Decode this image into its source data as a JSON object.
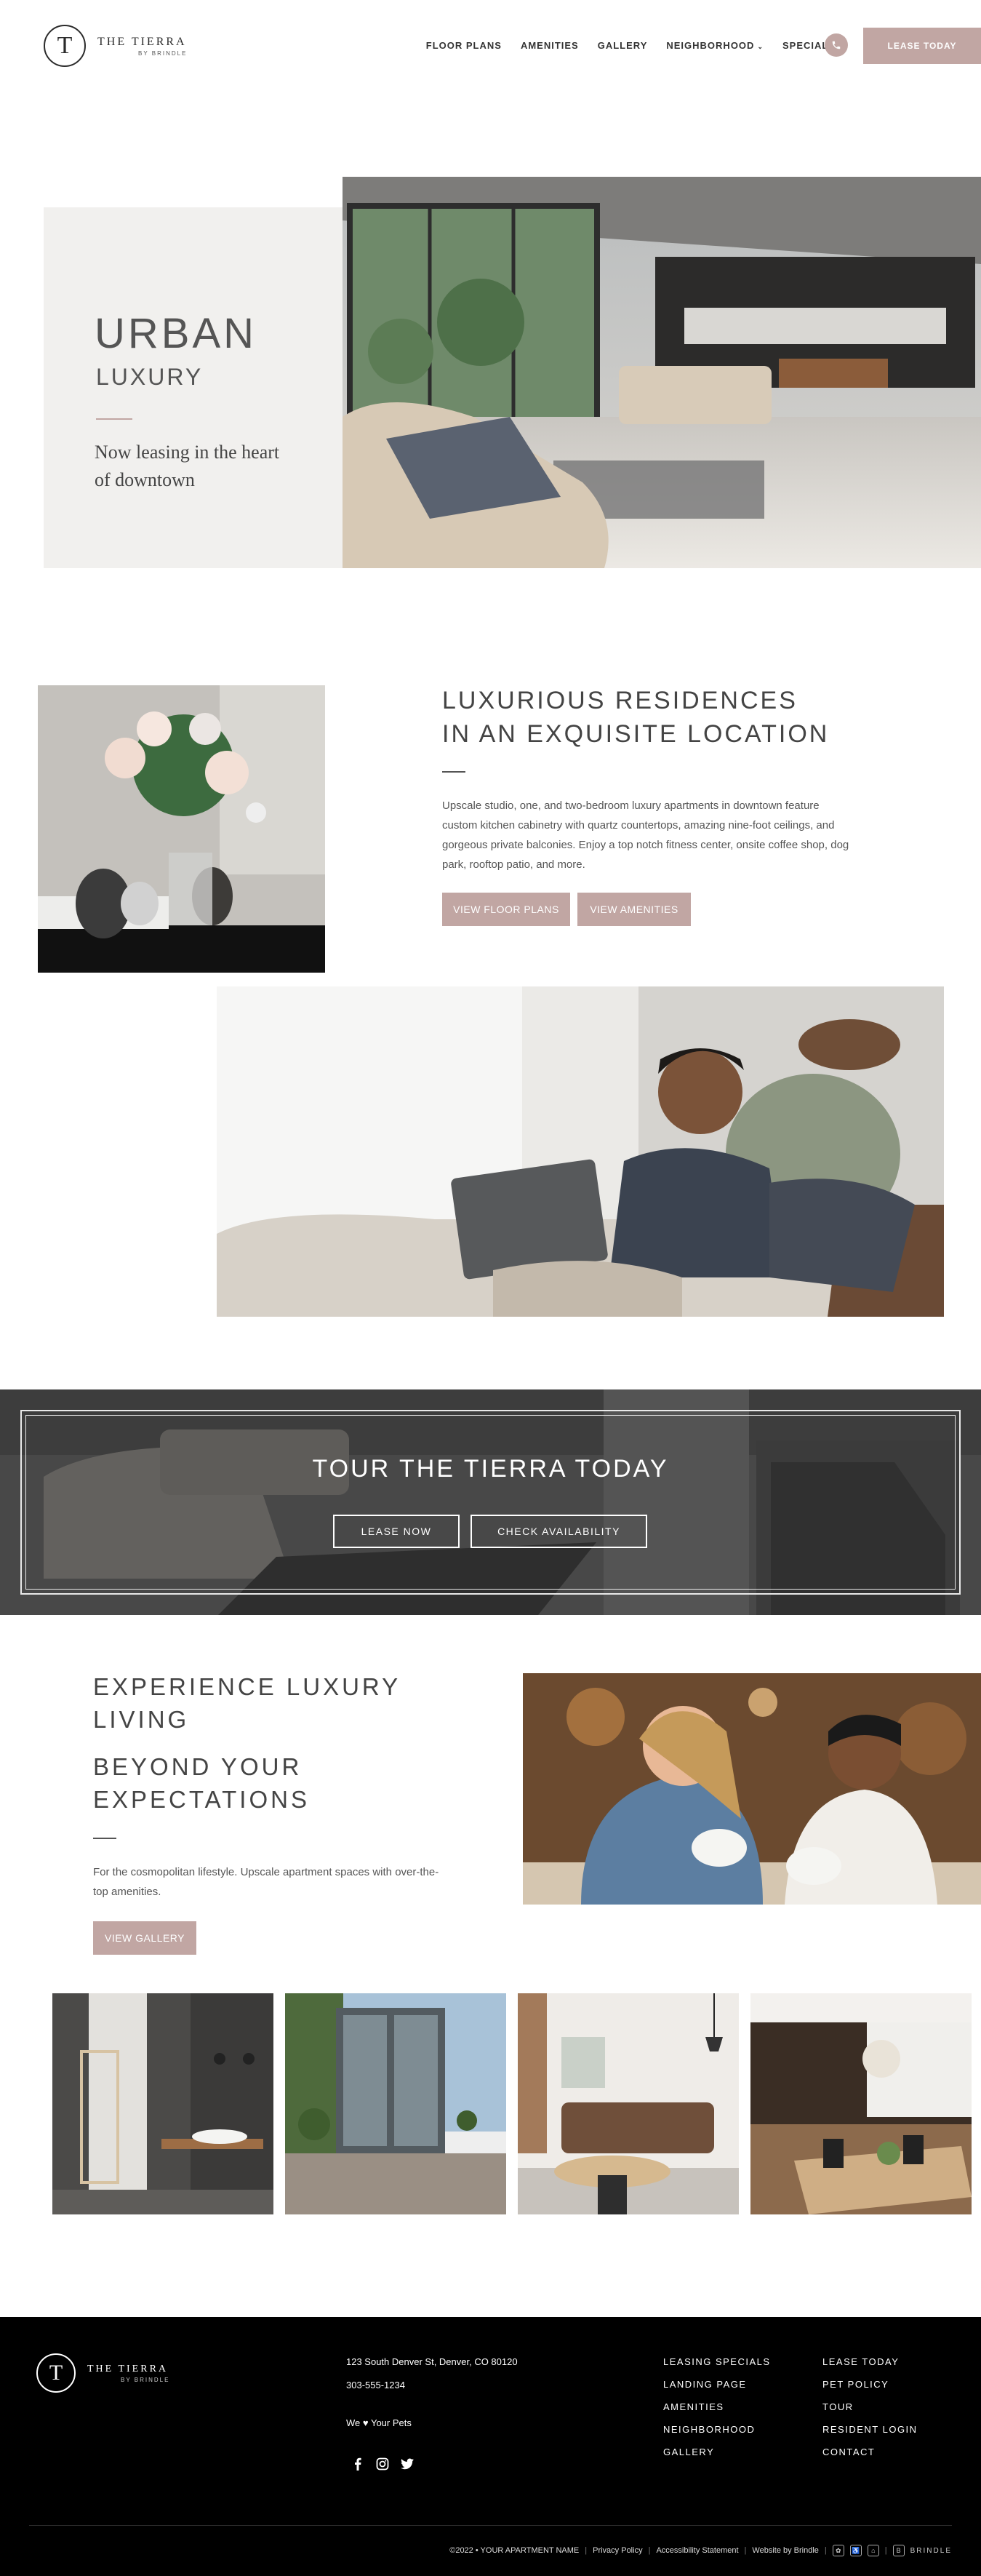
{
  "header": {
    "logo_letter": "T",
    "logo_name": "THE TIERRA",
    "logo_sub": "BY BRINDLE",
    "nav": [
      {
        "label": "FLOOR PLANS"
      },
      {
        "label": "AMENITIES"
      },
      {
        "label": "GALLERY"
      },
      {
        "label": "NEIGHBORHOOD"
      },
      {
        "label": "SPECIALS"
      }
    ],
    "lease_label": "LEASE TODAY"
  },
  "hero": {
    "title": "URBAN",
    "subtitle": "LUXURY",
    "tagline": "Now leasing in the heart of downtown"
  },
  "residences": {
    "heading_line1": "LUXURIOUS RESIDENCES",
    "heading_line2": "IN AN EXQUISITE LOCATION",
    "body": "Upscale studio, one, and two-bedroom luxury apartments in downtown feature custom kitchen cabinetry with quartz countertops, amazing nine-foot ceilings, and gorgeous private balconies. Enjoy a top notch fitness center, onsite coffee shop, dog park, rooftop patio, and more.",
    "btn_floor_plans": "VIEW FLOOR PLANS",
    "btn_amenities": "VIEW AMENITIES"
  },
  "tour": {
    "title": "TOUR THE TIERRA TODAY",
    "btn_lease": "LEASE NOW",
    "btn_availability": "CHECK AVAILABILITY"
  },
  "experience": {
    "heading1_line1": "EXPERIENCE LUXURY",
    "heading1_line2": "LIVING",
    "heading2_line1": "BEYOND YOUR",
    "heading2_line2": "EXPECTATIONS",
    "body": "For the cosmopolitan lifestyle. Upscale apartment spaces with over-the-top amenities.",
    "btn_gallery": "VIEW GALLERY"
  },
  "footer": {
    "logo_letter": "T",
    "logo_name": "THE TIERRA",
    "logo_sub": "BY BRINDLE",
    "address": "123 South Denver St, Denver, CO 80120",
    "phone": "303-555-1234",
    "pets": "We ♥ Your Pets",
    "links_col1": [
      "LEASING SPECIALS",
      "LANDING PAGE",
      "AMENITIES",
      "NEIGHBORHOOD",
      "GALLERY"
    ],
    "links_col2": [
      "LEASE TODAY",
      "PET POLICY",
      "TOUR",
      "RESIDENT LOGIN",
      "CONTACT"
    ],
    "copyright": "©2022 • YOUR APARTMENT NAME",
    "privacy": "Privacy Policy",
    "accessibility": "Accessibility Statement",
    "website_by": "Website by Brindle",
    "brindle_badge": "BRINDLE"
  },
  "colors": {
    "accent_rose": "#c1a6a3",
    "footer_bg": "#000000",
    "hero_box": "#f1f0ee"
  }
}
